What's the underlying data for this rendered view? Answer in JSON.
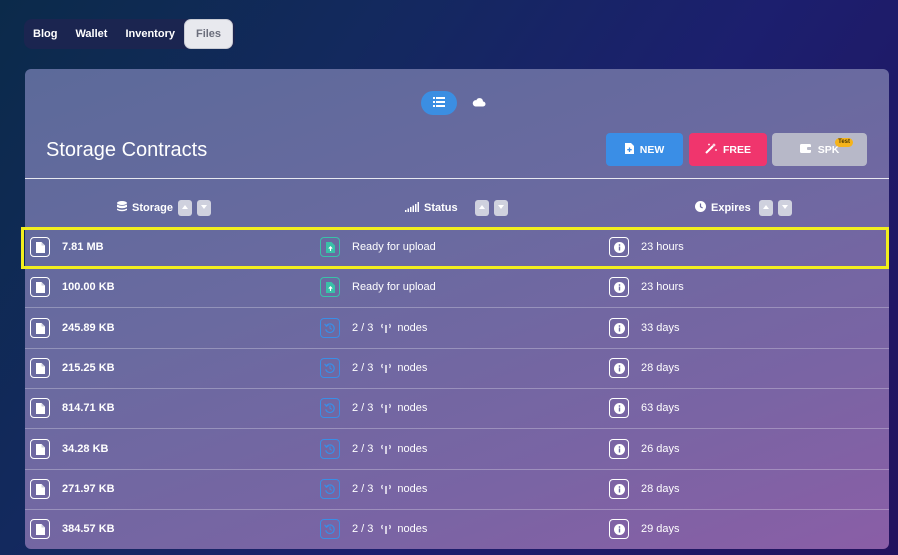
{
  "tabs": [
    {
      "label": "Blog",
      "active": false
    },
    {
      "label": "Wallet",
      "active": false
    },
    {
      "label": "Inventory",
      "active": false
    },
    {
      "label": "Files",
      "active": true
    }
  ],
  "panel": {
    "title": "Storage Contracts",
    "buttons": {
      "new": "NEW",
      "free": "FREE",
      "spk": "SPK",
      "spk_badge": "Test"
    },
    "view_toggle": {
      "list": "list-icon",
      "cloud": "cloud-icon"
    }
  },
  "columns": {
    "storage": "Storage",
    "status": "Status",
    "expires": "Expires"
  },
  "rows": [
    {
      "size": "7.81 MB",
      "status": "Ready for upload",
      "status_type": "ready",
      "expires": "23 hours"
    },
    {
      "size": "100.00 KB",
      "status": "Ready for upload",
      "status_type": "ready",
      "expires": "23 hours"
    },
    {
      "size": "245.89 KB",
      "status": "2 / 3",
      "status_type": "pending",
      "status_suffix": "nodes",
      "expires": "33 days"
    },
    {
      "size": "215.25 KB",
      "status": "2 / 3",
      "status_type": "pending",
      "status_suffix": "nodes",
      "expires": "28 days"
    },
    {
      "size": "814.71 KB",
      "status": "2 / 3",
      "status_type": "pending",
      "status_suffix": "nodes",
      "expires": "63 days"
    },
    {
      "size": "34.28 KB",
      "status": "2 / 3",
      "status_type": "pending",
      "status_suffix": "nodes",
      "expires": "26 days"
    },
    {
      "size": "271.97 KB",
      "status": "2 / 3",
      "status_type": "pending",
      "status_suffix": "nodes",
      "expires": "28 days"
    },
    {
      "size": "384.57 KB",
      "status": "2 / 3",
      "status_type": "pending",
      "status_suffix": "nodes",
      "expires": "29 days"
    }
  ],
  "colors": {
    "accent_blue": "#3a8ee6",
    "accent_pink": "#f0356d",
    "ready_green": "#39c1a8",
    "highlight": "#f2ee1e"
  }
}
